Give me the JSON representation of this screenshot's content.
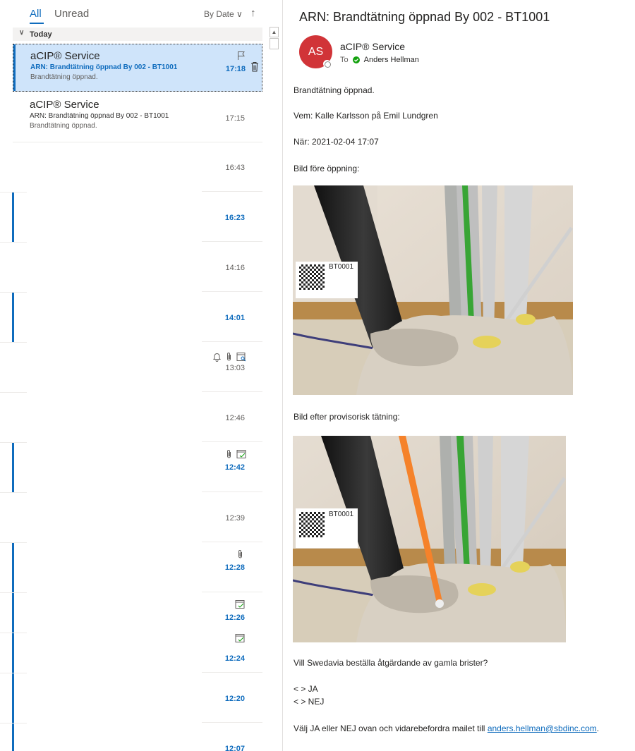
{
  "filter": {
    "all_label": "All",
    "unread_label": "Unread",
    "sort_label": "By Date",
    "sort_chevron": "∨",
    "sort_arrow": "↑"
  },
  "group": {
    "label": "Today"
  },
  "messages": [
    {
      "sender": "aCIP® Service",
      "subject": "ARN: Brandtätning öppnad By 002 - BT1001",
      "preview": "Brandtätning öppnad.",
      "time": "17:18"
    },
    {
      "sender": "aCIP® Service",
      "subject": "ARN: Brandtätning öppnad By 002 - BT1001",
      "preview": "Brandtätning öppnad.",
      "time": "17:15"
    },
    {
      "time": "16:43"
    },
    {
      "time": "16:23"
    },
    {
      "time": "14:16"
    },
    {
      "time": "14:01"
    },
    {
      "time": "13:03"
    },
    {
      "time": "12:46"
    },
    {
      "time": "12:42"
    },
    {
      "time": "12:39"
    },
    {
      "time": "12:28"
    },
    {
      "time": "12:26"
    },
    {
      "time": "12:24"
    },
    {
      "time": "12:20"
    },
    {
      "time": "12:07"
    }
  ],
  "reading": {
    "subject": "ARN: Brandtätning öppnad By 002 - BT1001",
    "avatar_initials": "AS",
    "from": "aCIP® Service",
    "to_label": "To",
    "to_name": "Anders Hellman",
    "body": {
      "line1": "Brandtätning öppnad.",
      "line2": "Vem: Kalle Karlsson på Emil Lundgren",
      "line3": "När: 2021-02-04 17:07",
      "line4": "Bild före öppning:",
      "line5": "Bild efter provisorisk tätning:",
      "line6": "Vill Swedavia beställa åtgärdande av gamla brister?",
      "option_ja": "< > JA",
      "option_nej": "< > NEJ",
      "closing_prefix": "Välj JA eller NEJ ovan och vidarebefordra mailet till",
      "email": "anders.hellman@sbdinc.com",
      "closing_suffix": "."
    },
    "photo_label": "BT0001"
  },
  "colors": {
    "accent": "#0f6cbd",
    "selected_bg": "#cfe4fa",
    "avatar": "#d13438",
    "presence_ok": "#13a10e",
    "orange_tube": "#f5822a"
  },
  "icons": {
    "flag": "flag-icon",
    "trash": "trash-icon",
    "bell": "bell-icon",
    "paperclip": "paperclip-icon",
    "calendar": "calendar-check-icon"
  }
}
